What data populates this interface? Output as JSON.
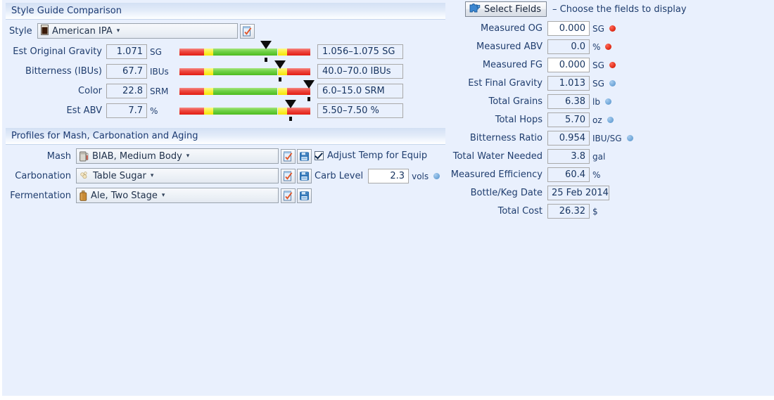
{
  "colors": {
    "page_background": "#e9f0fd",
    "text": "#1f3d6e",
    "header_gradient_top": "#d3e0f4",
    "status_red": "#e02b16",
    "status_blue": "#6fa6d8",
    "bar_red": "#e21d12",
    "bar_yellow": "#f6e606",
    "bar_green": "#4cbb1f"
  },
  "style_section": {
    "header": "Style Guide Comparison",
    "style_label": "Style",
    "style_value": "American IPA",
    "style_icon": "beer-glass-icon",
    "style_pick_icon": "checklist-icon",
    "rows": [
      {
        "label": "Est Original Gravity",
        "value": "1.071",
        "unit": "SG",
        "range": "1.056–1.075 SG",
        "marker_pct": 66,
        "bar": {
          "red_left_pct": 0,
          "yellow_left_pct": 19,
          "green_pct": 49,
          "yellow_right_pct": 7,
          "red_right_pct": 18
        }
      },
      {
        "label": "Bitterness (IBUs)",
        "value": "67.7",
        "unit": "IBUs",
        "range": "40.0–70.0 IBUs",
        "marker_pct": 77,
        "bar": {
          "red_left_pct": 0,
          "yellow_left_pct": 19,
          "green_pct": 49,
          "yellow_right_pct": 7,
          "red_right_pct": 18
        }
      },
      {
        "label": "Color",
        "value": "22.8",
        "unit": "SRM",
        "range": "6.0–15.0 SRM",
        "marker_pct": 99,
        "bar": {
          "red_left_pct": 0,
          "yellow_left_pct": 19,
          "green_pct": 49,
          "yellow_right_pct": 7,
          "red_right_pct": 18
        }
      },
      {
        "label": "Est ABV",
        "value": "7.7",
        "unit": "%",
        "range": "5.50–7.50 %",
        "marker_pct": 85,
        "bar": {
          "red_left_pct": 0,
          "yellow_left_pct": 19,
          "green_pct": 49,
          "yellow_right_pct": 7,
          "red_right_pct": 18
        }
      }
    ]
  },
  "profiles_section": {
    "header": "Profiles for Mash, Carbonation and Aging",
    "rows": [
      {
        "label": "Mash",
        "value": "BIAB, Medium Body",
        "icon": "mash-tun-icon",
        "has_save": true
      },
      {
        "label": "Carbonation",
        "value": "Table Sugar",
        "icon": "sugar-icon",
        "has_save": true
      },
      {
        "label": "Fermentation",
        "value": "Ale, Two Stage",
        "icon": "fermenter-icon",
        "has_save": true
      }
    ],
    "pick_icon": "checklist-icon",
    "save_icon": "floppy-disk-icon",
    "adjust_temp_label": "Adjust Temp for Equip",
    "adjust_temp_checked": true,
    "carb_level_label": "Carb Level",
    "carb_level_value": "2.3",
    "carb_level_unit": "vols",
    "carb_level_dot": "blue"
  },
  "fields_panel": {
    "select_fields_button": "Select Fields",
    "select_fields_icon": "puzzle-piece-icon",
    "hint": "– Choose the fields to display",
    "rows": [
      {
        "label": "Measured OG",
        "value": "0.000",
        "unit": "SG",
        "dot": "red",
        "editable": true
      },
      {
        "label": "Measured ABV",
        "value": "0.0",
        "unit": "%",
        "dot": "red",
        "editable": false
      },
      {
        "label": "Measured FG",
        "value": "0.000",
        "unit": "SG",
        "dot": "red",
        "editable": true
      },
      {
        "label": "Est Final Gravity",
        "value": "1.013",
        "unit": "SG",
        "dot": "blue",
        "editable": false
      },
      {
        "label": "Total Grains",
        "value": "6.38",
        "unit": "lb",
        "dot": "blue",
        "editable": false
      },
      {
        "label": "Total Hops",
        "value": "5.70",
        "unit": "oz",
        "dot": "blue",
        "editable": false
      },
      {
        "label": "Bitterness Ratio",
        "value": "0.954",
        "unit": "IBU/SG",
        "dot": "blue",
        "editable": false
      },
      {
        "label": "Total Water Needed",
        "value": "3.8",
        "unit": "gal",
        "dot": "",
        "editable": false
      },
      {
        "label": "Measured Efficiency",
        "value": "60.4",
        "unit": "%",
        "dot": "",
        "editable": false
      },
      {
        "label": "Bottle/Keg Date",
        "value": "25 Feb 2014",
        "unit": "",
        "dot": "",
        "editable": false,
        "align": "left"
      },
      {
        "label": "Total Cost",
        "value": "26.32",
        "unit": "$",
        "dot": "",
        "editable": false
      }
    ]
  }
}
